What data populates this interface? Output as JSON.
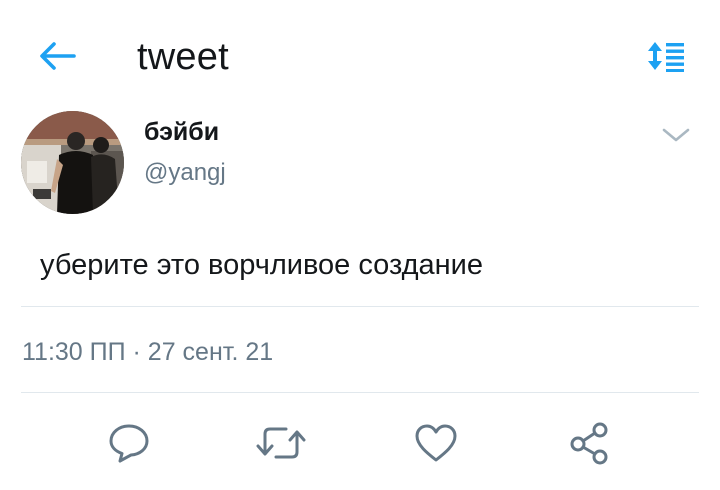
{
  "header": {
    "title": "tweet",
    "back_icon": "arrow-left-icon",
    "sort_icon": "sort-order-icon",
    "accent_color": "#1da1f2"
  },
  "author": {
    "display_name": "бэйби",
    "handle": "@yangj",
    "avatar": "user-avatar-photo",
    "menu_icon": "chevron-down-icon"
  },
  "tweet": {
    "text": "уберите это ворчливое создание",
    "timestamp": "11:30 ПП · 27 сент. 21"
  },
  "actions": {
    "reply_icon": "reply-icon",
    "retweet_icon": "retweet-icon",
    "like_icon": "heart-icon",
    "share_icon": "share-icon",
    "icon_color": "#657786"
  }
}
